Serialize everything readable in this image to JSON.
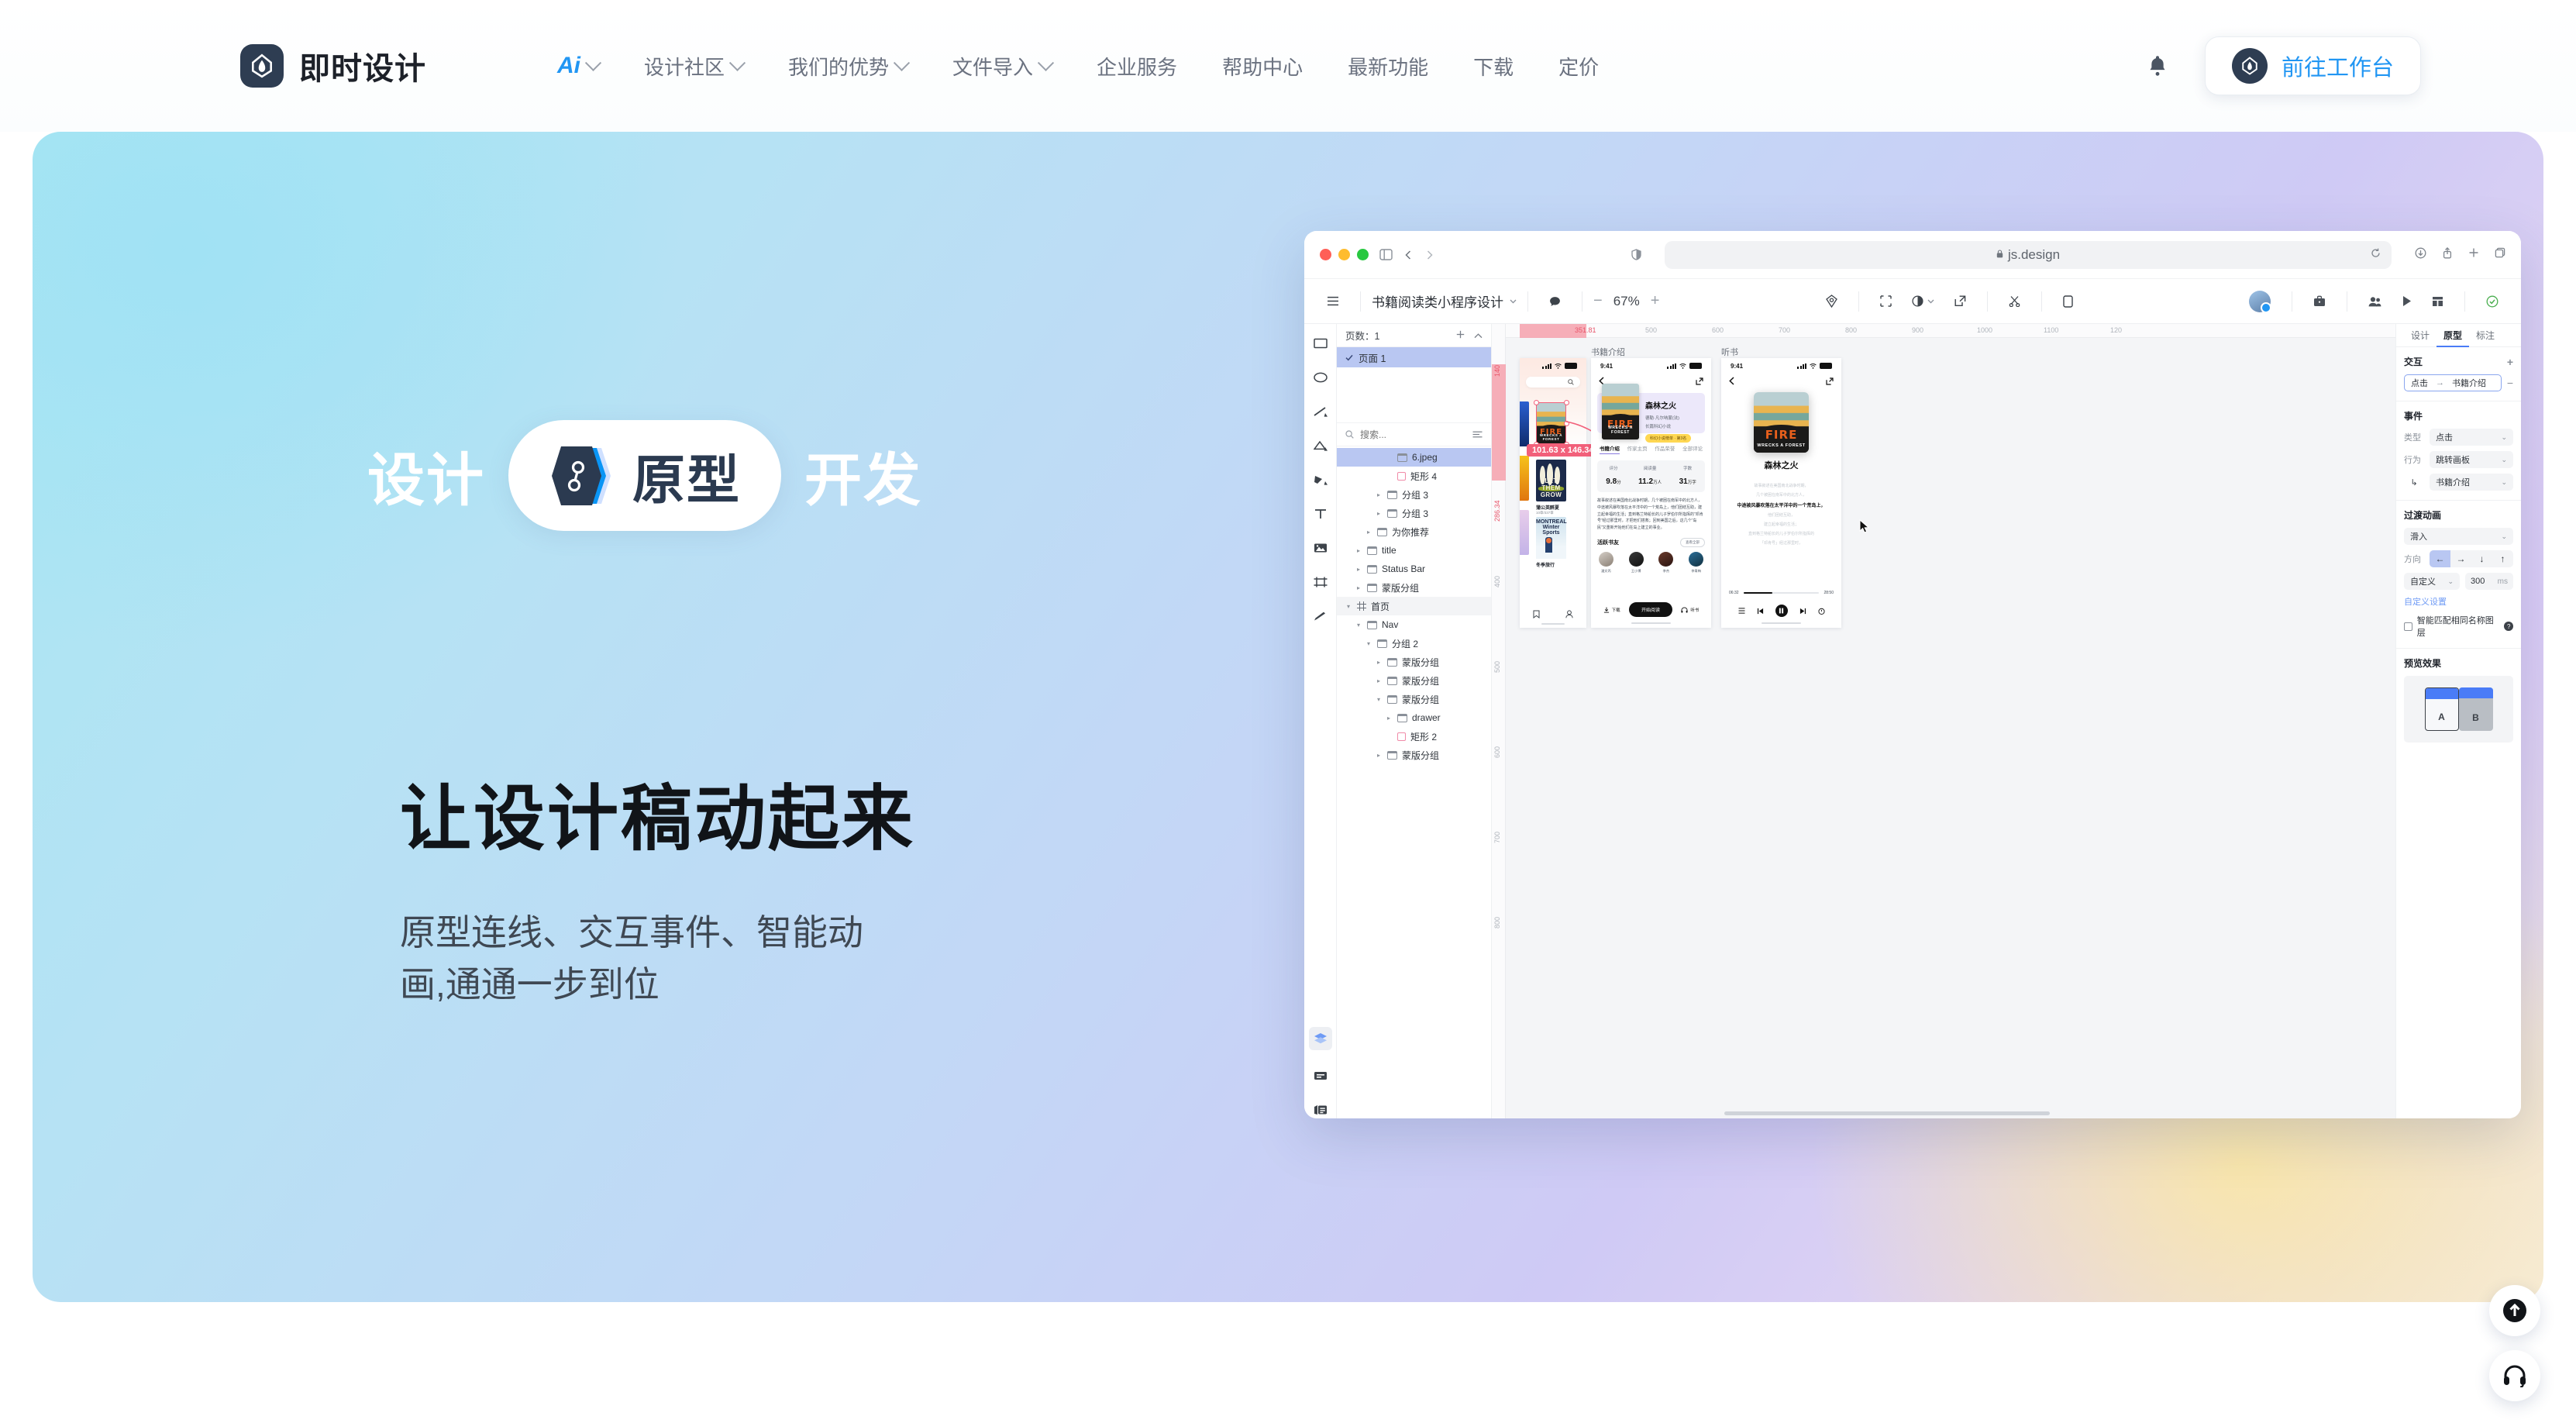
{
  "header": {
    "brand_name": "即时设计",
    "nav": [
      {
        "label": "Ai",
        "has_caret": true,
        "accent": true
      },
      {
        "label": "设计社区",
        "has_caret": true
      },
      {
        "label": "我们的优势",
        "has_caret": true
      },
      {
        "label": "文件导入",
        "has_caret": true
      },
      {
        "label": "企业服务",
        "has_caret": false
      },
      {
        "label": "帮助中心",
        "has_caret": false
      },
      {
        "label": "最新功能",
        "has_caret": false
      },
      {
        "label": "下载",
        "has_caret": false
      },
      {
        "label": "定价",
        "has_caret": false
      }
    ],
    "bell_icon": "bell-icon",
    "cta_label": "前往工作台"
  },
  "hero": {
    "pill_left": "设计",
    "pill_center": "原型",
    "pill_right": "开发",
    "headline": "让设计稿动起来",
    "subline_1": "原型连线、交互事件、智能动",
    "subline_2": "画,通通一步到位"
  },
  "browser": {
    "url": "js.design",
    "lock_icon": "lock-icon",
    "reload_icon": "reload-icon",
    "back_icon": "chevron-left-icon",
    "forward_icon": "chevron-right-icon",
    "sidebar_icon": "sidebar-toggle-icon",
    "shield_icon": "shield-icon",
    "download_icon": "download-icon",
    "share_icon": "share-icon",
    "newtab_icon": "plus-icon",
    "tabs_icon": "tabs-icon"
  },
  "app": {
    "menu_icon": "hamburger-icon",
    "file_name": "书籍阅读类小程序设计",
    "zoom_value": "67%",
    "zoom_out": "−",
    "zoom_in": "+",
    "toolbar_icons": [
      "comment-icon",
      "prototype-icon",
      "select-frame-icon",
      "component-icon",
      "export-icon",
      "scissors-icon",
      "device-preview-icon"
    ],
    "right_icons": [
      "avatar",
      "briefcase-icon",
      "collaborators-icon",
      "play-icon",
      "layout-icon",
      "saved-check-icon"
    ],
    "rail_icons": [
      "rectangle-tool",
      "ellipse-tool",
      "line-tool",
      "triangle-tool",
      "pen-tool",
      "text-tool",
      "image-tool",
      "frame-tool",
      "pencil-tool",
      "layers-panel",
      "components-panel",
      "assets-panel"
    ]
  },
  "layers": {
    "pages_label": "页数：1",
    "add_icon": "plus-icon",
    "collapse_icon": "chevron-up-icon",
    "page_item": "页面 1",
    "search_placeholder": "搜索...",
    "sort_icon": "sort-icon",
    "tree": [
      {
        "label": "6.jpeg",
        "indent": 4,
        "icon": "image",
        "arrow": "",
        "state": "selected"
      },
      {
        "label": "矩形 4",
        "indent": 4,
        "icon": "rect",
        "arrow": "",
        "state": ""
      },
      {
        "label": "分组 3",
        "indent": 3,
        "icon": "folder",
        "arrow": "▸",
        "state": ""
      },
      {
        "label": "分组 3",
        "indent": 3,
        "icon": "folder",
        "arrow": "▸",
        "state": ""
      },
      {
        "label": "为你推荐",
        "indent": 2,
        "icon": "folder",
        "arrow": "▸",
        "state": ""
      },
      {
        "label": "title",
        "indent": 1,
        "icon": "folder",
        "arrow": "▸",
        "state": ""
      },
      {
        "label": "Status Bar",
        "indent": 1,
        "icon": "folder",
        "arrow": "▸",
        "state": ""
      },
      {
        "label": "蒙版分组",
        "indent": 1,
        "icon": "folder",
        "arrow": "▸",
        "state": ""
      },
      {
        "label": "首页",
        "indent": 0,
        "icon": "frame",
        "arrow": "▾",
        "state": "soft"
      },
      {
        "label": "Nav",
        "indent": 1,
        "icon": "folder",
        "arrow": "▾",
        "state": ""
      },
      {
        "label": "分组 2",
        "indent": 2,
        "icon": "folder",
        "arrow": "▾",
        "state": ""
      },
      {
        "label": "蒙版分组",
        "indent": 3,
        "icon": "folder",
        "arrow": "▸",
        "state": ""
      },
      {
        "label": "蒙版分组",
        "indent": 3,
        "icon": "folder",
        "arrow": "▸",
        "state": ""
      },
      {
        "label": "蒙版分组",
        "indent": 3,
        "icon": "folder",
        "arrow": "▾",
        "state": ""
      },
      {
        "label": "drawer",
        "indent": 4,
        "icon": "folder",
        "arrow": "▸",
        "state": ""
      },
      {
        "label": "矩形 2",
        "indent": 4,
        "icon": "rect",
        "arrow": "",
        "state": ""
      },
      {
        "label": "蒙版分组",
        "indent": 3,
        "icon": "folder",
        "arrow": "▸",
        "state": ""
      }
    ]
  },
  "canvas": {
    "ruler_h_ticks": [
      "351.81",
      "500",
      "600",
      "700",
      "800",
      "900",
      "1000",
      "1100",
      "120"
    ],
    "ruler_v_ticks": [
      "140",
      "286.34",
      "400",
      "500",
      "600",
      "700",
      "800"
    ],
    "artboard_labels": [
      "书籍介绍",
      "听书"
    ],
    "selection_size": "101.63 x 146.34",
    "cursor_icon": "cursor-arrow"
  },
  "screen_home": {
    "search_icon": "search-icon",
    "books": [
      {
        "title": "",
        "meta": "10章/337章",
        "cover": "fire"
      },
      {
        "title": "蒲公英醉夏",
        "meta": "10章/337章",
        "cover": "grow"
      },
      {
        "title": "冬季旅行",
        "meta": "",
        "cover": "winter"
      }
    ],
    "tab_bookmark": "bookmark-icon",
    "tab_profile": "profile-icon"
  },
  "screen_detail": {
    "time": "9:41",
    "back_icon": "chevron-left-icon",
    "share_icon": "share-icon",
    "book_title": "森林之火",
    "author": "德勒·凡尔呐蒙(法)",
    "genre": "长篇科幻小说",
    "badge": "科幻小说榜单 · 第3名",
    "tabs": [
      "书籍介绍",
      "作家主页",
      "作品荣誉",
      "全部评论"
    ],
    "active_tab": "书籍介绍",
    "stats": [
      {
        "label": "评分",
        "value": "9.8",
        "unit": "分"
      },
      {
        "label": "阅读量",
        "value": "11.2",
        "unit": "万人"
      },
      {
        "label": "字数",
        "value": "31",
        "unit": "万字"
      }
    ],
    "description": "故事叙述在美国南北战争时期，几个被困在南军中的北方人，中途被风暴吹落在太平洋中的一个荒岛上，他们团结互助，建立起幸福的生活；直到格兰特船长的儿子罗伯尔所指挥的“邓肯号”经过那里时，才把他们搭救；回到美国之后，这几个“岛民”又重新开始他们在岛上建立的事业。",
    "friends_title": "活跃书友",
    "friends_more": "查看全部",
    "friends": [
      "潘文丙",
      "王小博",
      "李杰",
      "李青梅"
    ],
    "action_download": "下载",
    "action_read": "开始阅读",
    "action_listen": "听书",
    "download_icon": "download-icon",
    "headphone_icon": "headphone-icon"
  },
  "screen_listen": {
    "time": "9:41",
    "back_icon": "chevron-left-icon",
    "share_icon": "share-icon",
    "book_title": "森林之火",
    "lyrics": [
      "故事叙述在美国南北战争时期，",
      "几个被困在南军中的北方人，",
      "中途被风暴吹落在太平洋中的一个荒岛上，",
      "他们团结互助，",
      "建立起幸福的生活；",
      "直到格兰特船长的儿子罗伯尔所指挥的",
      "「邓肯号」经过那里时，"
    ],
    "active_lyric_index": 2,
    "time_current": "06:32",
    "time_total": "28:50",
    "controls": [
      "list-icon",
      "prev-icon",
      "pause-icon",
      "next-icon",
      "timer-icon"
    ]
  },
  "props": {
    "tabs": [
      "设计",
      "原型",
      "标注"
    ],
    "active_tab": "原型",
    "interaction_title": "交互",
    "add_icon": "plus-icon",
    "remove_icon": "minus-icon",
    "interaction_trigger": "点击",
    "interaction_arrow": "→",
    "interaction_target": "书籍介绍",
    "event_title": "事件",
    "event_type_label": "类型",
    "event_type_value": "点击",
    "event_action_label": "行为",
    "event_action_value": "跳转画板",
    "event_target_icon": "corner-arrow-icon",
    "event_target_value": "书籍介绍",
    "transition_title": "过渡动画",
    "transition_value": "滑入",
    "direction_label": "方向",
    "directions": [
      "←",
      "→",
      "↓",
      "↑"
    ],
    "active_direction": "←",
    "easing_value": "自定义",
    "duration_value": "300",
    "duration_unit": "ms",
    "custom_settings": "自定义设置",
    "smart_match_label": "智能匹配相同名称图层",
    "preview_title": "预览效果",
    "preview_a": "A",
    "preview_b": "B"
  },
  "fab": {
    "back_to_top": "arrow-up-icon",
    "support": "headset-icon"
  },
  "colors": {
    "accent_blue": "#2196f3",
    "brand_dark": "#2e3d52",
    "select_pink": "#f2607a",
    "panel_blue": "#4a7cf7"
  }
}
